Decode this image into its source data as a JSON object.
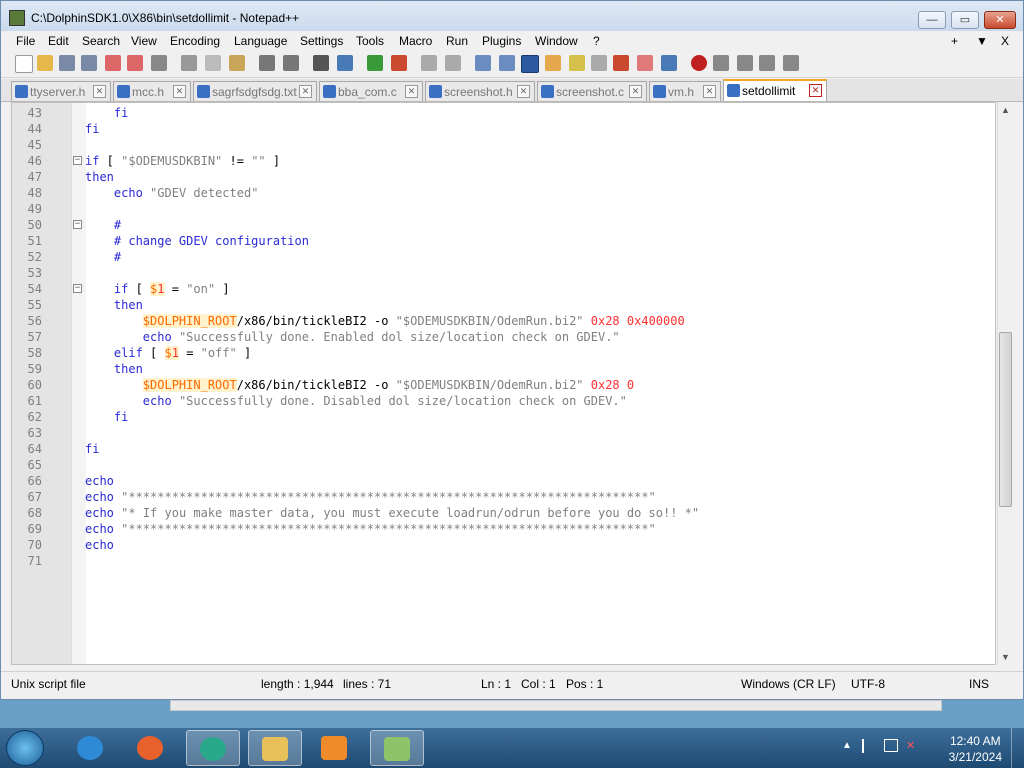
{
  "window": {
    "title": "C:\\DolphinSDK1.0\\X86\\bin\\setdollimit - Notepad++"
  },
  "menu": [
    "File",
    "Edit",
    "Search",
    "View",
    "Encoding",
    "Language",
    "Settings",
    "Tools",
    "Macro",
    "Run",
    "Plugins",
    "Window",
    "?"
  ],
  "menu_right": [
    "+",
    "▼",
    "X"
  ],
  "tabs": [
    {
      "label": "ttyserver.h",
      "active": false
    },
    {
      "label": "mcc.h",
      "active": false
    },
    {
      "label": "sagrfsdgfsdg.txt",
      "active": false
    },
    {
      "label": "bba_com.c",
      "active": false
    },
    {
      "label": "screenshot.h",
      "active": false
    },
    {
      "label": "screenshot.c",
      "active": false
    },
    {
      "label": "vm.h",
      "active": false
    },
    {
      "label": "setdollimit",
      "active": true
    }
  ],
  "code_lines": [
    {
      "n": "43",
      "t": "    fi"
    },
    {
      "n": "44",
      "t": "fi"
    },
    {
      "n": "45",
      "t": ""
    },
    {
      "n": "46",
      "t": "if [ \"$ODEMUSDKBIN\" != \"\" ]"
    },
    {
      "n": "47",
      "t": "then"
    },
    {
      "n": "48",
      "t": "    echo \"GDEV detected\""
    },
    {
      "n": "49",
      "t": ""
    },
    {
      "n": "50",
      "t": "    #"
    },
    {
      "n": "51",
      "t": "    # change GDEV configuration"
    },
    {
      "n": "52",
      "t": "    #"
    },
    {
      "n": "53",
      "t": ""
    },
    {
      "n": "54",
      "t": "    if [ $1 = \"on\" ]"
    },
    {
      "n": "55",
      "t": "    then"
    },
    {
      "n": "56",
      "t": "        $DOLPHIN_ROOT/x86/bin/tickleBI2 -o \"$ODEMUSDKBIN/OdemRun.bi2\" 0x28 0x400000"
    },
    {
      "n": "57",
      "t": "        echo \"Successfully done. Enabled dol size/location check on GDEV.\""
    },
    {
      "n": "58",
      "t": "    elif [ $1 = \"off\" ]"
    },
    {
      "n": "59",
      "t": "    then"
    },
    {
      "n": "60",
      "t": "        $DOLPHIN_ROOT/x86/bin/tickleBI2 -o \"$ODEMUSDKBIN/OdemRun.bi2\" 0x28 0"
    },
    {
      "n": "61",
      "t": "        echo \"Successfully done. Disabled dol size/location check on GDEV.\""
    },
    {
      "n": "62",
      "t": "    fi"
    },
    {
      "n": "63",
      "t": ""
    },
    {
      "n": "64",
      "t": "fi"
    },
    {
      "n": "65",
      "t": ""
    },
    {
      "n": "66",
      "t": "echo"
    },
    {
      "n": "67",
      "t": "echo \"************************************************************************\""
    },
    {
      "n": "68",
      "t": "echo \"* If you make master data, you must execute loadrun/odrun before you do so!! *\""
    },
    {
      "n": "69",
      "t": "echo \"************************************************************************\""
    },
    {
      "n": "70",
      "t": "echo"
    },
    {
      "n": "71",
      "t": ""
    }
  ],
  "status": {
    "file_type": "Unix script file",
    "length": "length : 1,944",
    "lines": "lines : 71",
    "ln": "Ln : 1",
    "col": "Col : 1",
    "pos": "Pos : 1",
    "eol": "Windows (CR LF)",
    "encoding": "UTF-8",
    "mode": "INS"
  },
  "taskbar": {
    "apps": [
      "internet-explorer-icon",
      "firefox-icon",
      "chat-app-icon",
      "file-explorer-icon",
      "media-player-icon",
      "notepadpp-icon"
    ],
    "time": "12:40 AM",
    "date": "3/21/2024"
  }
}
